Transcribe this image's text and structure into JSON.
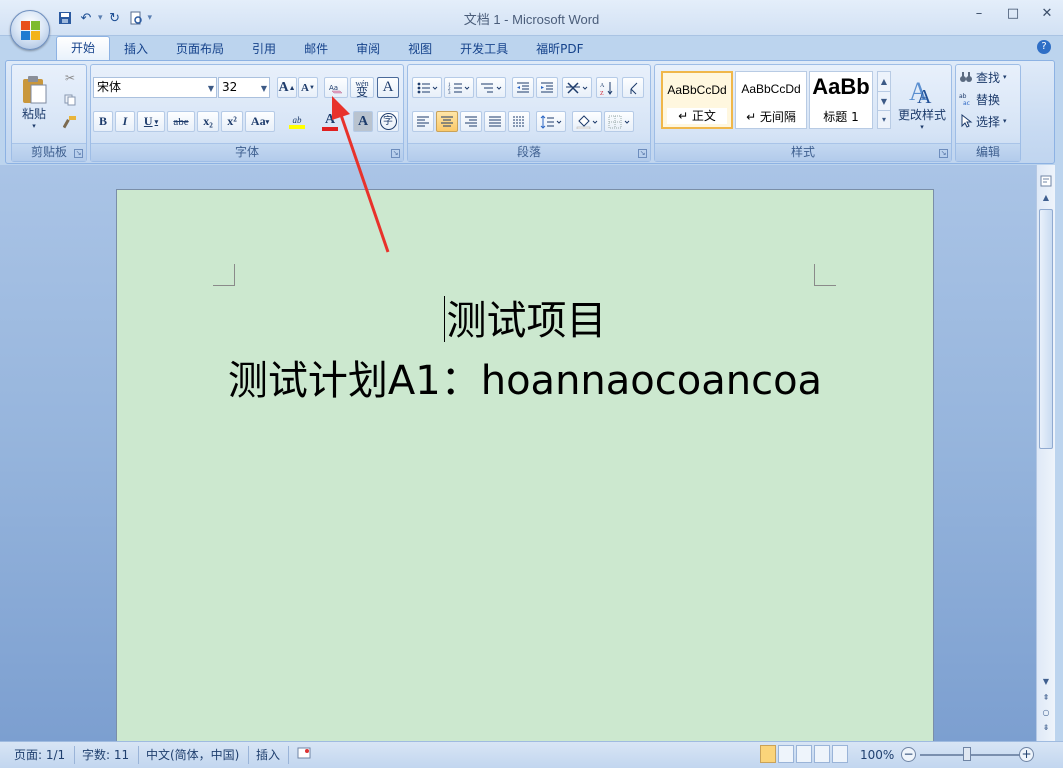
{
  "window": {
    "title": "文档 1 - Microsoft Word",
    "controls": {
      "minimize": "–",
      "maximize": "□",
      "close": "✕"
    }
  },
  "quick_access": [
    "save-icon",
    "undo-icon",
    "redo-icon",
    "print-preview-icon",
    "customize-icon"
  ],
  "tabs": [
    {
      "label": "开始",
      "active": true
    },
    {
      "label": "插入"
    },
    {
      "label": "页面布局"
    },
    {
      "label": "引用"
    },
    {
      "label": "邮件"
    },
    {
      "label": "审阅"
    },
    {
      "label": "视图"
    },
    {
      "label": "开发工具"
    },
    {
      "label": "福昕PDF"
    }
  ],
  "ribbon": {
    "clipboard": {
      "label": "剪贴板",
      "paste_label": "粘贴"
    },
    "font": {
      "label": "字体",
      "font_name": "宋体",
      "font_size": "32",
      "buttons": {
        "grow": "A",
        "shrink": "A",
        "bold": "B",
        "italic": "I",
        "underline": "U",
        "strike": "abe",
        "sub": "x₂",
        "sup": "x²",
        "case": "Aa",
        "highlight": "ab",
        "color": "A",
        "shade": "A",
        "border": "A",
        "enclose": "字",
        "phonetic": "wén",
        "phonetic_char": "变"
      }
    },
    "paragraph": {
      "label": "段落"
    },
    "styles": {
      "label": "样式",
      "items": [
        {
          "sample": "AaBbCcDd",
          "name": "↵ 正文",
          "selected": true
        },
        {
          "sample": "AaBbCcDd",
          "name": "↵ 无间隔"
        },
        {
          "sample": "AaBb",
          "name": "标题 1"
        }
      ],
      "change_label": "更改样式"
    },
    "editing": {
      "label": "编辑",
      "find": "查找",
      "replace": "替换",
      "select": "选择"
    }
  },
  "document": {
    "line1": "测试项目",
    "line2": "测试计划A1：hoannaocoancoa",
    "background_color": "#cce8cf"
  },
  "status": {
    "page": "页面: 1/1",
    "words": "字数: 11",
    "language": "中文(简体，中国)",
    "mode": "插入",
    "zoom": "100%"
  }
}
